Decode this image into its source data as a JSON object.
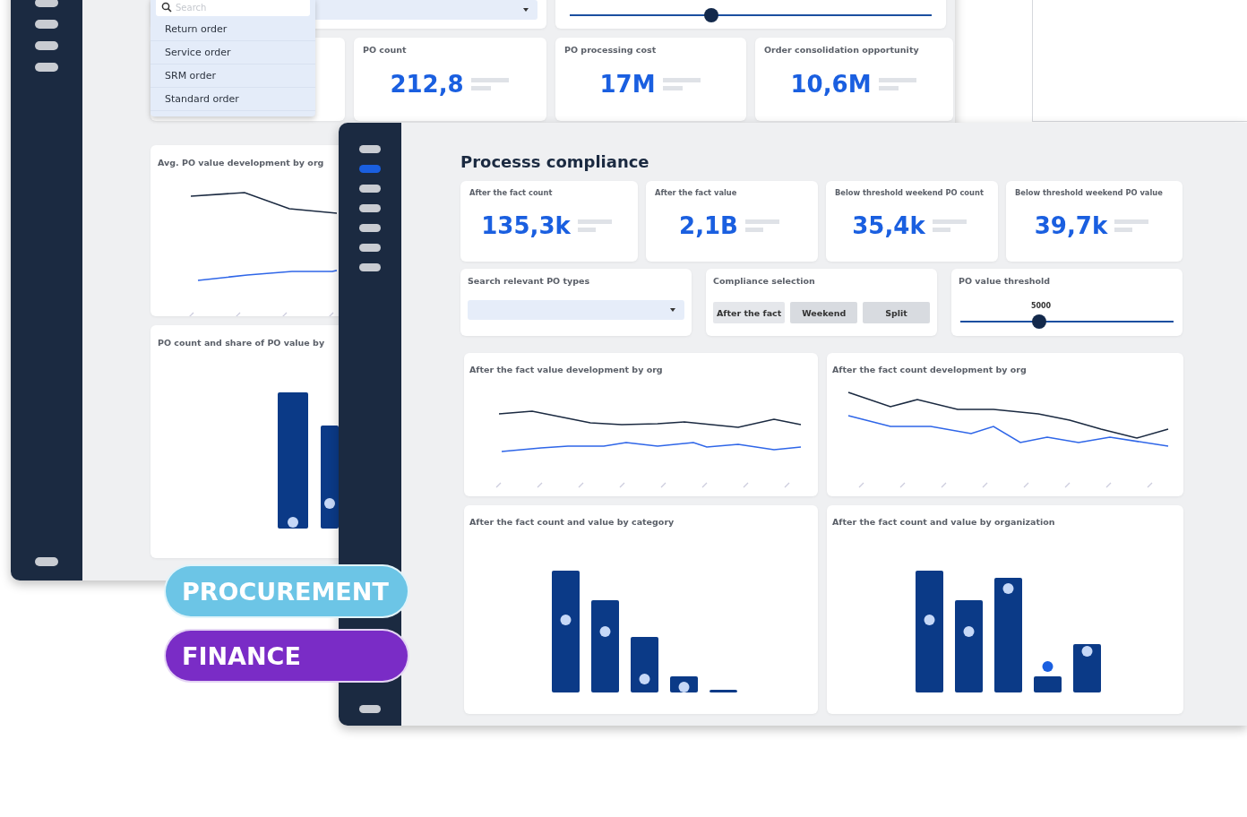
{
  "back_window": {
    "search": {
      "placeholder": "Search"
    },
    "dropdown_options": [
      "Return order",
      "Service order",
      "SRM order",
      "Standard order"
    ],
    "slider": {
      "level": 0.39
    },
    "kpis": [
      {
        "label": "PO count",
        "value": "212,8"
      },
      {
        "label": "PO processing cost",
        "value": "17M"
      },
      {
        "label": "Order consolidation opportunity",
        "value": "10,6M"
      }
    ],
    "charts": [
      {
        "title": "Avg. PO value development by org",
        "kind": "line"
      },
      {
        "title": "PO count and share of PO value by",
        "kind": "bar"
      }
    ]
  },
  "front_window": {
    "sidebar_items": [
      {
        "selected": false
      },
      {
        "selected": true
      },
      {
        "selected": false
      },
      {
        "selected": false
      },
      {
        "selected": false
      },
      {
        "selected": false
      },
      {
        "selected": false
      }
    ],
    "title": "Processs compliance",
    "kpis": [
      {
        "label": "After the fact count",
        "value": "135,3k"
      },
      {
        "label": "After the fact value",
        "value": "2,1B"
      },
      {
        "label": "Below threshold weekend PO count",
        "value": "35,4k"
      },
      {
        "label": "Below threshold weekend PO value",
        "value": "39,7k"
      }
    ],
    "po_types": {
      "label": "Search relevant PO types"
    },
    "compliance": {
      "label": "Compliance selection",
      "options": [
        {
          "label": "After the fact",
          "selected": true
        },
        {
          "label": "Weekend",
          "selected": false
        },
        {
          "label": "Split",
          "selected": false
        }
      ]
    },
    "threshold": {
      "label": "PO value threshold",
      "reading": "5000",
      "level": 0.37
    },
    "charts": [
      {
        "title": "After the fact value development by org",
        "kind": "line"
      },
      {
        "title": "After the fact count development by org",
        "kind": "line"
      },
      {
        "title": "After the fact count and value by category",
        "kind": "bar"
      },
      {
        "title": "After the fact count and value by organization",
        "kind": "bar"
      }
    ]
  },
  "tags": [
    {
      "label": "PROCUREMENT",
      "color": "#6cc5e6"
    },
    {
      "label": "FINANCE",
      "color": "#7a2cc6"
    }
  ]
}
